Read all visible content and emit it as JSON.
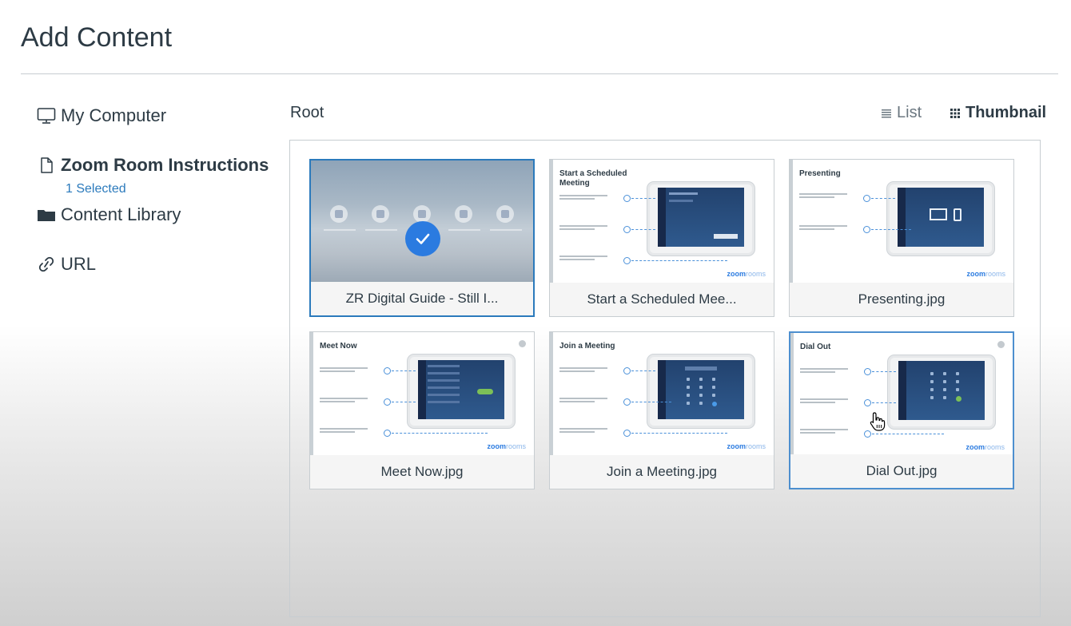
{
  "page": {
    "title": "Add Content"
  },
  "sidebar": {
    "items": [
      {
        "label": "My Computer",
        "icon": "monitor-icon"
      },
      {
        "label": "Zoom Room Instructions",
        "icon": "file-icon",
        "selected_count": "1 Selected"
      },
      {
        "label": "Content Library",
        "icon": "folder-icon"
      },
      {
        "label": "URL",
        "icon": "link-icon"
      }
    ]
  },
  "toolbar": {
    "breadcrumb": "Root",
    "list_label": "List",
    "thumbnail_label": "Thumbnail",
    "active_view": "Thumbnail"
  },
  "thumbnails": [
    {
      "caption": "ZR Digital Guide - Still I...",
      "selected": true
    },
    {
      "caption": "Start a Scheduled Mee...",
      "heading": "Start a Scheduled Meeting",
      "brand": "zoom",
      "brand_suffix": "rooms"
    },
    {
      "caption": "Presenting.jpg",
      "heading": "Presenting",
      "brand": "zoom",
      "brand_suffix": "rooms"
    },
    {
      "caption": "Meet Now.jpg",
      "heading": "Meet Now",
      "brand": "zoom",
      "brand_suffix": "rooms"
    },
    {
      "caption": "Join a Meeting.jpg",
      "heading": "Join a Meeting",
      "brand": "zoom",
      "brand_suffix": "rooms"
    },
    {
      "caption": "Dial Out.jpg",
      "heading": "Dial Out",
      "brand": "zoom",
      "brand_suffix": "rooms",
      "hovered": true
    }
  ],
  "colors": {
    "accent": "#2b7abc",
    "check": "#2b7be0",
    "text": "#2d3b45",
    "muted": "#6b7780"
  }
}
